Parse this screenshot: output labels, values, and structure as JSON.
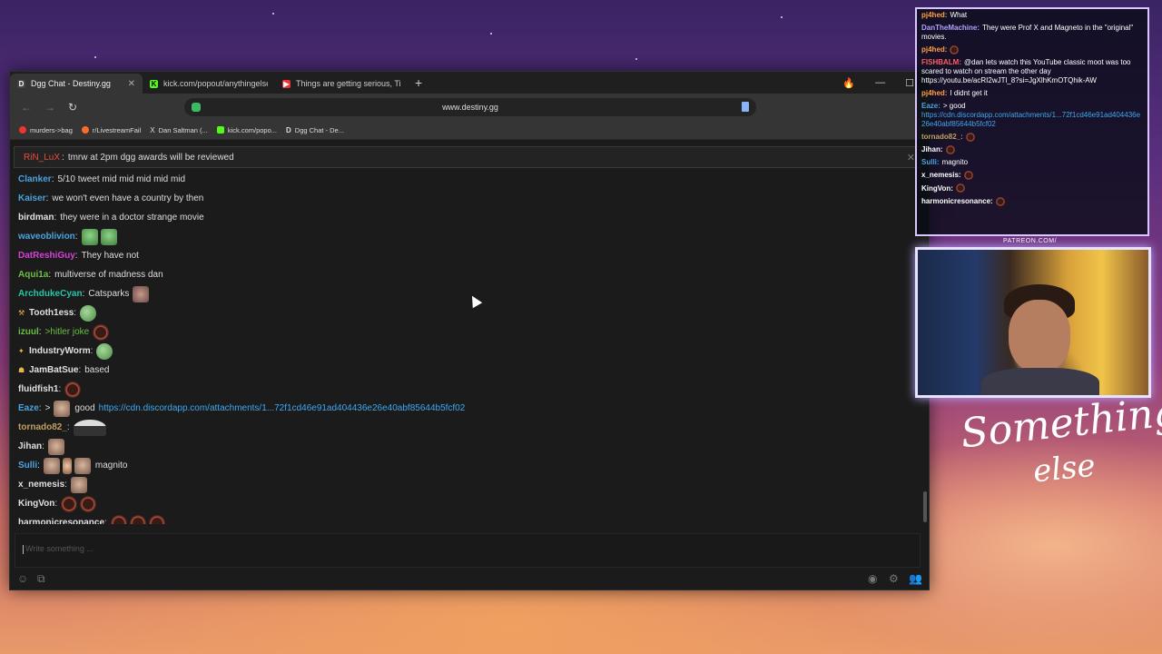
{
  "browser": {
    "tabs": [
      {
        "label": "Dgg Chat - Destiny.gg",
        "active": true,
        "icon": "destiny-favicon"
      },
      {
        "label": "kick.com/popout/anythingelse/chat",
        "active": false,
        "icon": "kick-favicon"
      },
      {
        "label": "Things are getting serious, Tim Wa",
        "active": false,
        "icon": "youtube-favicon"
      }
    ],
    "new_tab_label": "+",
    "url": "www.destiny.gg",
    "bookmarks": [
      {
        "label": "murders->bag",
        "icon": "youtube-favicon"
      },
      {
        "label": "r/LivestreamFail",
        "icon": "reddit-favicon"
      },
      {
        "label": "Dan Saltman (...",
        "icon": "x-favicon"
      },
      {
        "label": "kick.com/popo...",
        "icon": "kick-favicon"
      },
      {
        "label": "Dgg Chat - De...",
        "icon": "destiny-favicon"
      }
    ]
  },
  "pinned": {
    "user": "RiN_LuX",
    "text": "tmrw at 2pm dgg awards will be reviewed"
  },
  "chat": {
    "messages": [
      {
        "user": "Clanker",
        "color": "#4aa3df",
        "text": "5/10 tweet mid mid mid mid mid",
        "emotes": []
      },
      {
        "user": "Kaiser",
        "color": "#4aa3df",
        "text": "we won't even have a country by then",
        "emotes": []
      },
      {
        "user": "birdman",
        "color": "#e0e0e0",
        "text": "they were in a doctor strange movie",
        "emotes": []
      },
      {
        "user": "waveoblivion",
        "color": "#4aa3df",
        "text": "",
        "emotes": [
          "pepe",
          "pepe"
        ]
      },
      {
        "user": "DatReshiGuy",
        "color": "#d541d5",
        "text": "They have not",
        "emotes": []
      },
      {
        "user": "Aqui1a",
        "color": "#6bbd45",
        "text": "multiverse of madness dan",
        "emotes": []
      },
      {
        "user": "ArchdukeCyan",
        "color": "#27c4a8",
        "text": "Catsparks",
        "emotes": [
          "cat"
        ]
      },
      {
        "user": "Tooth1ess",
        "color": "#e0e0e0",
        "text": "",
        "emotes": [
          "frog"
        ],
        "badge": "⚒"
      },
      {
        "user": "izuul",
        "color": "#6bbd45",
        "text": ">hitler joke",
        "emotes": [
          "ball"
        ],
        "green": true
      },
      {
        "user": "IndustryWorm",
        "color": "#e0e0e0",
        "text": "",
        "emotes": [
          "frog"
        ],
        "badge": "✦"
      },
      {
        "user": "JamBatSue",
        "color": "#e0e0e0",
        "text": "based",
        "emotes": [],
        "badge": "☗"
      },
      {
        "user": "fluidfish1",
        "color": "#e0e0e0",
        "text": "",
        "emotes": [
          "ball"
        ]
      },
      {
        "user": "Eaze",
        "color": "#4aa3df",
        "text": ">",
        "emotes": [
          "face"
        ],
        "after": "good",
        "link": "https://cdn.discordapp.com/attachments/1...72f1cd46e91ad404436e26e40abf85644b5fcf02"
      },
      {
        "user": "tornado82_",
        "color": "#c0a060",
        "text": "",
        "emotes": [
          "man"
        ]
      },
      {
        "user": "Jihan",
        "color": "#e0e0e0",
        "text": "",
        "emotes": [
          "face"
        ]
      },
      {
        "user": "Sulli",
        "color": "#4aa3df",
        "text": "",
        "emotes": [
          "face",
          "hand",
          "face"
        ],
        "after": "magnito"
      },
      {
        "user": "x_nemesis",
        "color": "#e0e0e0",
        "text": "",
        "emotes": [
          "face"
        ]
      },
      {
        "user": "KingVon",
        "color": "#e0e0e0",
        "text": "",
        "emotes": [
          "ball",
          "ball"
        ]
      },
      {
        "user": "harmonicresonance",
        "color": "#e0e0e0",
        "text": "",
        "emotes": [
          "ball",
          "ball",
          "ball"
        ]
      }
    ],
    "input_placeholder": "Write something ..."
  },
  "overlay_chat": {
    "lines": [
      {
        "user": "pj4hed:",
        "color": "#ff9f43",
        "text": "What"
      },
      {
        "user": "DanTheMachine:",
        "color": "#b0a0ff",
        "text": "They were Prof X and Magneto in the \"original\" movies."
      },
      {
        "user": "pj4hed:",
        "color": "#ff9f43",
        "text": ""
      },
      {
        "user": "FISHBALM:",
        "color": "#ff5e5e",
        "text": "@dan lets watch this YouTube classic moot was too scared to watch on stream the other day https://youtu.be/acRI2wJTl_8?si=JgXlhKmOTQhik-AW"
      },
      {
        "user": "pj4hed:",
        "color": "#ff9f43",
        "text": "I didnt get it"
      },
      {
        "user": "Eaze:",
        "color": "#4aa3df",
        "text": "> good",
        "link": "https://cdn.discordapp.com/attachments/1...72f1cd46e91ad404436e26e40abf85644b5fcf02"
      },
      {
        "user": "tornado82_:",
        "color": "#c0a060",
        "text": ""
      },
      {
        "user": "Jihan:",
        "color": "#ffffff",
        "text": ""
      },
      {
        "user": "Sulli:",
        "color": "#4aa3df",
        "text": "magnito"
      },
      {
        "user": "x_nemesis:",
        "color": "#ffffff",
        "text": ""
      },
      {
        "user": "KingVon:",
        "color": "#ffffff",
        "text": ""
      },
      {
        "user": "harmonicresonance:",
        "color": "#ffffff",
        "text": ""
      }
    ]
  },
  "patreon_label": "PATREON.COM/",
  "brand_line1": "Something",
  "brand_line2": "else"
}
